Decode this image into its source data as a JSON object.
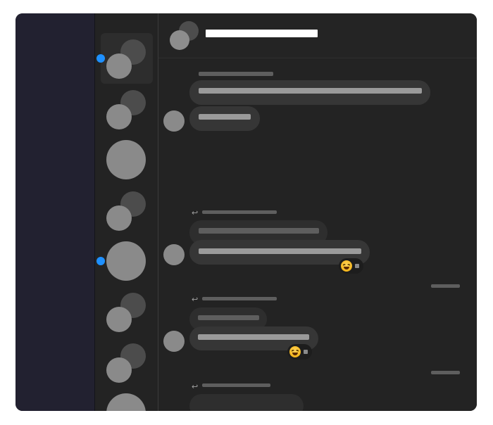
{
  "colors": {
    "side_strip": "#222130",
    "panel": "#232323",
    "bubble": "#363636",
    "unread": "#1e90ff",
    "title_redaction": "#ffffff"
  },
  "header": {
    "title": "",
    "avatar_icon": "group-avatar-icon"
  },
  "conversations": [
    {
      "avatar": "group-avatar-icon",
      "selected": true,
      "unread": true
    },
    {
      "avatar": "group-avatar-icon",
      "selected": false,
      "unread": false
    },
    {
      "avatar": "single-avatar-icon",
      "selected": false,
      "unread": false
    },
    {
      "avatar": "group-avatar-icon",
      "selected": false,
      "unread": false
    },
    {
      "avatar": "single-avatar-icon",
      "selected": false,
      "unread": true
    },
    {
      "avatar": "group-avatar-icon",
      "selected": false,
      "unread": false
    },
    {
      "avatar": "group-avatar-icon",
      "selected": false,
      "unread": false
    },
    {
      "avatar": "single-avatar-icon",
      "selected": false,
      "unread": false
    }
  ],
  "messages": [
    {
      "sender": "",
      "text_lines": [
        "",
        ""
      ],
      "reaction": null
    },
    {
      "sender": "",
      "reply_to": "",
      "text_lines": [
        "",
        ""
      ],
      "reaction": {
        "emoji": "laughing-emoji-icon",
        "count": ""
      },
      "timestamp": ""
    },
    {
      "sender": "",
      "reply_to": "",
      "text_lines": [
        "",
        ""
      ],
      "reaction": {
        "emoji": "laughing-emoji-icon",
        "count": ""
      },
      "timestamp": ""
    },
    {
      "sender": "",
      "reply_to": "",
      "text_lines": [
        ""
      ],
      "reaction": null
    }
  ]
}
